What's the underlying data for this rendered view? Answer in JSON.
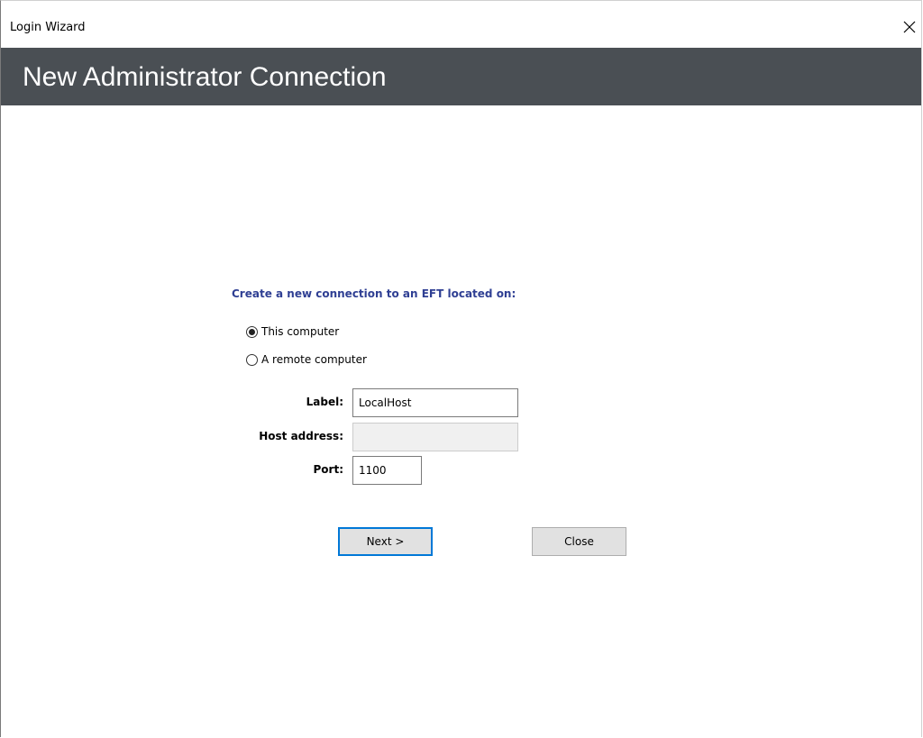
{
  "window": {
    "title": "Login Wizard"
  },
  "header": {
    "heading": "New Administrator Connection"
  },
  "form": {
    "prompt": "Create a new connection to an EFT located on:",
    "options": [
      {
        "label": "This computer",
        "selected": true
      },
      {
        "label": "A remote computer",
        "selected": false
      }
    ],
    "label_field": {
      "label": "Label:",
      "value": "LocalHost"
    },
    "host_field": {
      "label": "Host address:",
      "value": ""
    },
    "port_field": {
      "label": "Port:",
      "value": "1100"
    }
  },
  "buttons": {
    "next_label": "Next >",
    "close_label": "Close"
  },
  "icons": {
    "close": "close-icon"
  },
  "colors": {
    "banner": "#4a4f54",
    "prompt_text": "#2f3f93",
    "default_button_border": "#0078d7"
  }
}
